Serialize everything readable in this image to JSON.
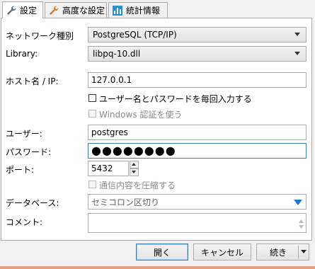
{
  "tabs": [
    {
      "label": "設定",
      "icon": "wrench-icon"
    },
    {
      "label": "高度な設定",
      "icon": "wrench-orange-icon"
    },
    {
      "label": "統計情報",
      "icon": "bar-chart-icon"
    }
  ],
  "form": {
    "network_type_label": "ネットワーク種別",
    "network_type_value": "PostgreSQL (TCP/IP)",
    "library_label": "Library:",
    "library_value": "libpq-10.dll",
    "host_label": "ホスト名 / IP:",
    "host_value": "127.0.0.1",
    "prompt_credentials_label": "ユーザー名とパスワードを毎回入力する",
    "windows_auth_label": "Windows 認証を使う",
    "user_label": "ユーザー:",
    "user_value": "postgres",
    "password_label": "パスワード:",
    "password_mask": "●●●●●●●●",
    "port_label": "ポート:",
    "port_value": "5432",
    "compress_label": "通信内容を圧縮する",
    "database_label": "データベース:",
    "database_placeholder": "セミコロン区切り",
    "comment_label": "コメント:",
    "comment_value": ""
  },
  "buttons": {
    "open": "開く",
    "cancel": "キャンセル",
    "continue": "続き"
  },
  "colors": {
    "accent_blue": "#1e7bd8",
    "focus_border": "#3c7fb1"
  }
}
